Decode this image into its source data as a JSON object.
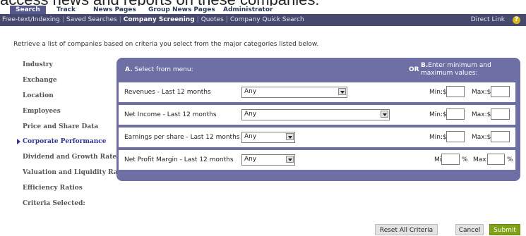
{
  "caption": "access news and reports on these companies.",
  "top_nav": {
    "tabs": [
      "Search",
      "Track",
      "News Pages",
      "Group News Pages",
      "Administrator"
    ],
    "active": "Search"
  },
  "sub_nav": {
    "items": [
      "Free-text/Indexing",
      "Saved Searches",
      "Company Screening",
      "Quotes",
      "Company Quick Search"
    ],
    "active": "Company Screening",
    "direct_link": "Direct Link",
    "help": "?"
  },
  "description": "Retrieve a list of companies based on criteria you select from the major categories listed below.",
  "sidebar": {
    "items": [
      "Industry",
      "Exchange",
      "Location",
      "Employees",
      "Price and Share Data",
      "Corporate Performance",
      "Dividend and Growth Rates",
      "Valuation and Liquidity Ratios",
      "Efficiency Ratios",
      "Criteria Selected:"
    ],
    "active": "Corporate Performance"
  },
  "panel": {
    "section_a_prefix": "A.",
    "section_a_text": "Select from menu:",
    "or": "OR",
    "section_b_prefix": "B.",
    "section_b_text": "Enter minimum and maximum values:"
  },
  "criteria": [
    {
      "label": "Revenues - Last 12 months",
      "value": "Any",
      "min_label": "Min:$",
      "max_label": "Max:$",
      "min": "",
      "max": "",
      "suffix": ""
    },
    {
      "label": "Net Income - Last 12 months",
      "value": "Any",
      "min_label": "Min:$",
      "max_label": "Max:$",
      "min": "",
      "max": "",
      "suffix": ""
    },
    {
      "label": "Earnings per share - Last 12 months",
      "value": "Any",
      "min_label": "Min:$",
      "max_label": "Max:$",
      "min": "",
      "max": "",
      "suffix": ""
    },
    {
      "label": "Net Profit Margin - Last 12 months",
      "value": "Any",
      "min_label": "Min:",
      "max_label": "Max:",
      "min": "",
      "max": "",
      "suffix": "%"
    }
  ],
  "buttons": {
    "reset": "Reset All Criteria",
    "cancel": "Cancel",
    "submit": "Submit"
  }
}
